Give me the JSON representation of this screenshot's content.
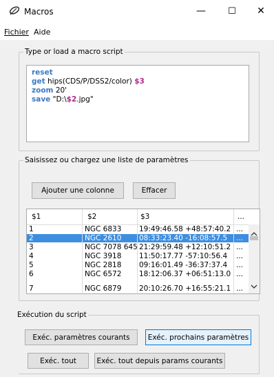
{
  "window": {
    "title": "Macros",
    "minimize": "—",
    "maximize": "☐",
    "close": "✕"
  },
  "menu": {
    "items": [
      "Fichier",
      "Aide"
    ]
  },
  "script_panel": {
    "legend": "Type or load a macro script",
    "lines": [
      {
        "kw": "reset",
        "rest": "",
        "param": ""
      },
      {
        "kw": "get",
        "rest": " hips(CDS/P/DSS2/color) ",
        "param": "$3"
      },
      {
        "kw": "zoom",
        "rest": " 20'",
        "param": ""
      },
      {
        "kw": "save",
        "rest": " \"D:\\",
        "param": "$2",
        "tail": ".jpg\""
      }
    ]
  },
  "params_panel": {
    "legend": "Saisissez ou chargez une liste de paramètres",
    "add_column": "Ajouter une colonne",
    "clear": "Effacer",
    "columns": [
      "$1",
      "$2",
      "$3",
      "..."
    ],
    "rows": [
      [
        "1",
        "NGC 6833",
        "19:49:46.58 +48:57:40.2",
        "..."
      ],
      [
        "2",
        "NGC 2610",
        "08:33:23.40 -16:08:57.5",
        "..."
      ],
      [
        "3",
        "NGC 7078 645",
        "21:29:59.48 +12:10:51.2",
        "..."
      ],
      [
        "4",
        "NGC 3918",
        "11:50:17.77 -57:10:56.4",
        "..."
      ],
      [
        "5",
        "NGC 2818",
        "09:16:01.49 -36:37:37.4",
        "..."
      ],
      [
        "6",
        "NGC 6572",
        "18:12:06.37 +06:51:13.0",
        "..."
      ],
      [
        "7",
        "NGC 6879",
        "20:10:26.70 +16:55:21.1",
        "..."
      ]
    ],
    "selected_row": 1
  },
  "exec_panel": {
    "legend": "Exécution du script",
    "run_current": "Exéc. paramètres courants",
    "run_next": "Exéc. prochains paramètres",
    "run_all": "Exéc. tout",
    "run_all_from_current": "Exéc. tout depuis params courants"
  }
}
